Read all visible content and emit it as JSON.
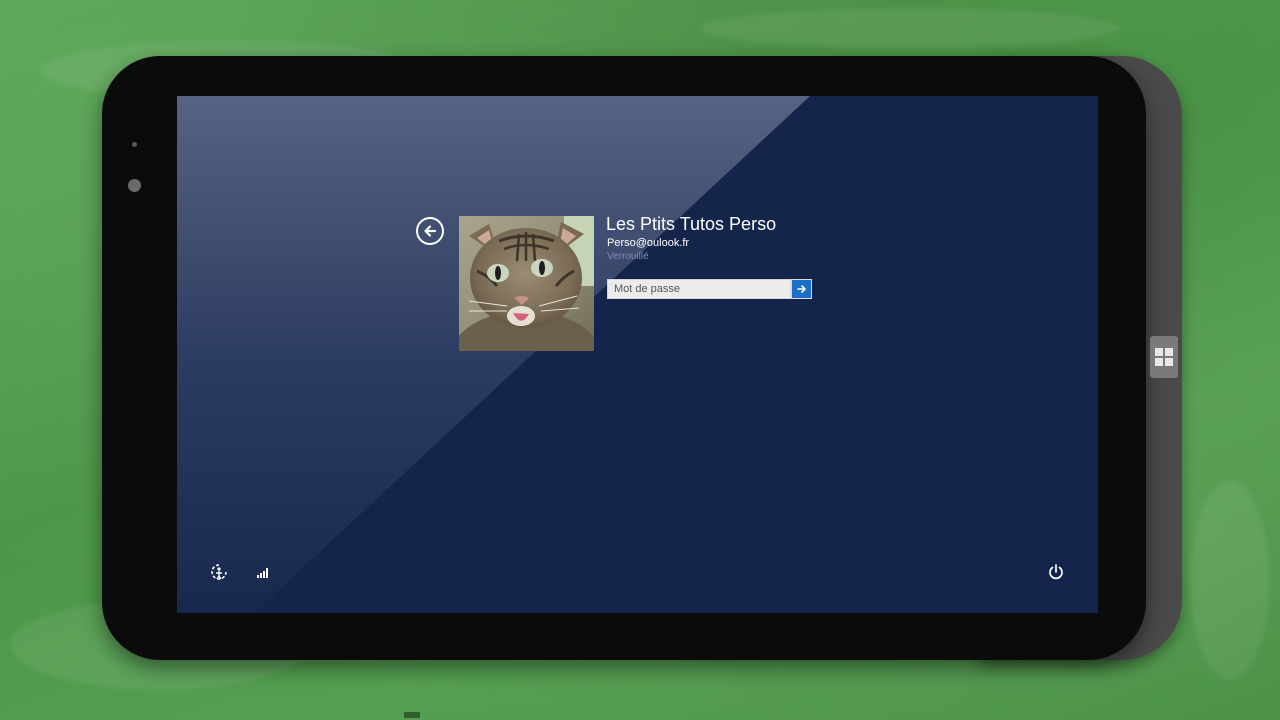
{
  "user": {
    "name": "Les Ptits Tutos Perso",
    "email": "Perso@oulook.fr",
    "status": "Verrouillé"
  },
  "password": {
    "placeholder": "Mot de passe",
    "value": ""
  },
  "icons": {
    "back": "back-arrow-icon",
    "submit": "arrow-right-icon",
    "ease_of_access": "ease-of-access-icon",
    "network": "network-signal-icon",
    "power": "power-icon",
    "windows": "windows-logo-icon"
  },
  "colors": {
    "screen_background": "#15244b",
    "accent": "#1c6fc7",
    "status_text": "#7f8fb5",
    "chalkboard": "#4f9a4b"
  }
}
